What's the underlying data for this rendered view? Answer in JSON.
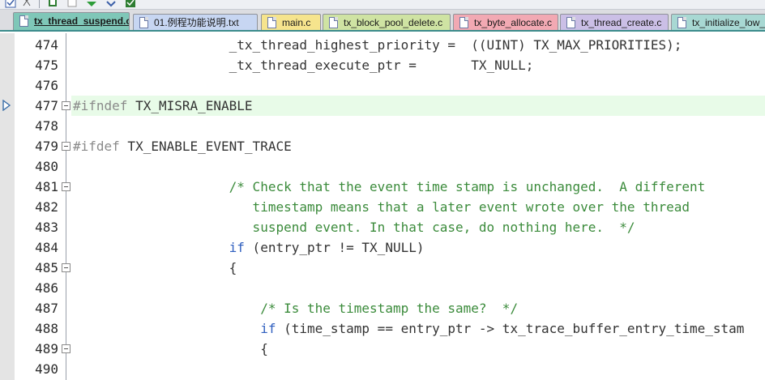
{
  "toolbar": {
    "buttons": [
      "checkbox-icon",
      "hierarchy-icon",
      "bookmark-toggle-icon",
      "bookmark-prev-icon",
      "bookmark-next-icon",
      "bookmark-clear-icon",
      "bookmark-list-icon"
    ]
  },
  "tabs": [
    {
      "label": "tx_thread_suspend.c",
      "color": "#7fc7b8",
      "active": true
    },
    {
      "label": "01.例程功能说明.txt",
      "color": "#c7d6f2",
      "active": false
    },
    {
      "label": "main.c",
      "color": "#f6e48d",
      "active": false
    },
    {
      "label": "tx_block_pool_delete.c",
      "color": "#cfe3a3",
      "active": false
    },
    {
      "label": "tx_byte_allocate.c",
      "color": "#f2a9b3",
      "active": false
    },
    {
      "label": "tx_thread_create.c",
      "color": "#cbbfe6",
      "active": false
    },
    {
      "label": "tx_initialize_low_",
      "color": "#a8d8d3",
      "active": false
    }
  ],
  "colors": {
    "accent": "#3c8c8c",
    "current_line": "#e8fbe8",
    "comment": "#3b8b3b",
    "keyword": "#2f5fbf",
    "preprocessor": "#8a8a8a"
  },
  "editor": {
    "current_line": 477,
    "lines": [
      {
        "num": "474",
        "fold": false,
        "segments": [
          {
            "t": "                    _tx_thread_highest_priority =  ((UINT) TX_MAX_PRIORITIES);",
            "k": "plain"
          }
        ]
      },
      {
        "num": "475",
        "fold": false,
        "segments": [
          {
            "t": "                    _tx_thread_execute_ptr =       TX_NULL;",
            "k": "plain"
          }
        ]
      },
      {
        "num": "476",
        "fold": false,
        "segments": []
      },
      {
        "num": "477",
        "fold": true,
        "segments": [
          {
            "t": "#ifndef",
            "k": "prep"
          },
          {
            "t": " TX_MISRA_ENABLE",
            "k": "plain"
          }
        ]
      },
      {
        "num": "478",
        "fold": false,
        "segments": []
      },
      {
        "num": "479",
        "fold": true,
        "segments": [
          {
            "t": "#ifdef",
            "k": "prep"
          },
          {
            "t": " TX_ENABLE_EVENT_TRACE",
            "k": "plain"
          }
        ]
      },
      {
        "num": "480",
        "fold": false,
        "segments": []
      },
      {
        "num": "481",
        "fold": true,
        "segments": [
          {
            "t": "                    /* Check that the event time stamp is unchanged.  A different",
            "k": "comment"
          }
        ]
      },
      {
        "num": "482",
        "fold": false,
        "segments": [
          {
            "t": "                       timestamp means that a later event wrote over the thread",
            "k": "comment"
          }
        ]
      },
      {
        "num": "483",
        "fold": false,
        "segments": [
          {
            "t": "                       suspend event. In that case, do nothing here.  */",
            "k": "comment"
          }
        ]
      },
      {
        "num": "484",
        "fold": false,
        "segments": [
          {
            "t": "                    ",
            "k": "plain"
          },
          {
            "t": "if",
            "k": "kw"
          },
          {
            "t": " (entry_ptr != TX_NULL)",
            "k": "plain"
          }
        ]
      },
      {
        "num": "485",
        "fold": true,
        "segments": [
          {
            "t": "                    {",
            "k": "plain"
          }
        ]
      },
      {
        "num": "486",
        "fold": false,
        "segments": []
      },
      {
        "num": "487",
        "fold": false,
        "segments": [
          {
            "t": "                        /* Is the timestamp the same?  */",
            "k": "comment"
          }
        ]
      },
      {
        "num": "488",
        "fold": false,
        "segments": [
          {
            "t": "                        ",
            "k": "plain"
          },
          {
            "t": "if",
            "k": "kw"
          },
          {
            "t": " (time_stamp == entry_ptr -> tx_trace_buffer_entry_time_stam",
            "k": "plain"
          }
        ]
      },
      {
        "num": "489",
        "fold": true,
        "segments": [
          {
            "t": "                        {",
            "k": "plain"
          }
        ]
      },
      {
        "num": "490",
        "fold": false,
        "segments": []
      }
    ]
  }
}
